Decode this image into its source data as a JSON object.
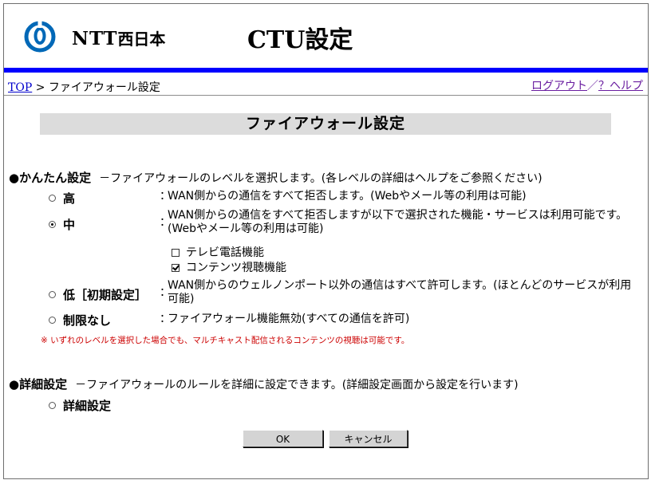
{
  "header": {
    "brand_latin": "NTT",
    "brand_ja": "西日本",
    "title": "CTU設定"
  },
  "nav": {
    "breadcrumb_top": "TOP",
    "breadcrumb_sep": " > ",
    "breadcrumb_current": "ファイアウォール設定",
    "logout": "ログアウト",
    "link_sep": "／",
    "help": "？ヘルプ"
  },
  "page_title": "ファイアウォール設定",
  "simple": {
    "bullet": "●",
    "label": "かんたん設定",
    "desc": "－ファイアウォールのレベルを選択します。(各レベルの詳細はヘルプをご参照ください)",
    "options": [
      {
        "label": "高",
        "checked": false,
        "colon": "：",
        "desc": "WAN側からの通信をすべて拒否します。(Webやメール等の利用は可能)"
      },
      {
        "label": "中",
        "checked": true,
        "colon": "：",
        "desc": "WAN側からの通信をすべて拒否しますが以下で選択された機能・サービスは利用可能です。(Webやメール等の利用は可能)"
      },
      {
        "label": "低［初期設定］",
        "checked": false,
        "colon": "：",
        "desc": "WAN側からのウェルノンポート以外の通信はすべて許可します。(ほとんどのサービスが利用可能)"
      },
      {
        "label": "制限なし",
        "checked": false,
        "colon": "：",
        "desc": "ファイアウォール機能無効(すべての通信を許可)"
      }
    ],
    "checkboxes": [
      {
        "label": "テレビ電話機能",
        "checked": false
      },
      {
        "label": "コンテンツ視聴機能",
        "checked": true
      }
    ],
    "note": "※ いずれのレベルを選択した場合でも、マルチキャスト配信されるコンテンツの視聴は可能です。"
  },
  "detail": {
    "bullet": "●",
    "label": "詳細設定",
    "desc": "－ファイアウォールのルールを詳細に設定できます。(詳細設定画面から設定を行います)",
    "option_label": "詳細設定",
    "option_checked": false
  },
  "buttons": {
    "ok": "OK",
    "cancel": "キャンセル"
  },
  "colors": {
    "accent_bar": "#0000ff",
    "logo_blue": "#0068b7",
    "note_red": "#cc0000",
    "link_visited": "#6a1ea0",
    "link": "#0000cc"
  }
}
